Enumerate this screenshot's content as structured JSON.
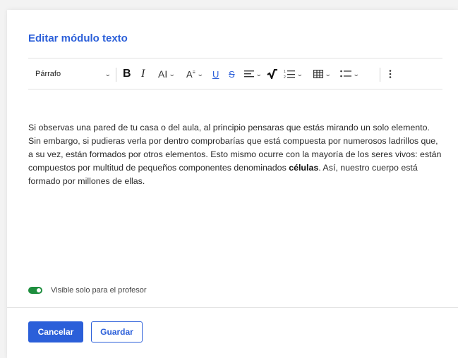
{
  "dialog": {
    "title": "Editar módulo texto"
  },
  "toolbar": {
    "paragraph_style": "Párrafo",
    "tools": [
      {
        "name": "paragraph-style-dropdown",
        "icon": "chevron-down-icon"
      },
      {
        "name": "bold-button",
        "icon": "bold-icon",
        "glyph": "B"
      },
      {
        "name": "italic-button",
        "icon": "italic-icon",
        "glyph": "I"
      },
      {
        "name": "font-size-button",
        "icon": "font-size-icon",
        "glyph": "AI"
      },
      {
        "name": "text-color-button",
        "icon": "text-color-icon",
        "glyph": "A"
      },
      {
        "name": "underline-button",
        "icon": "underline-icon",
        "glyph": "U"
      },
      {
        "name": "strikethrough-button",
        "icon": "strikethrough-icon",
        "glyph": "S"
      },
      {
        "name": "align-button",
        "icon": "align-left-icon"
      },
      {
        "name": "math-button",
        "icon": "square-root-icon"
      },
      {
        "name": "numbered-list-button",
        "icon": "numbered-list-icon"
      },
      {
        "name": "table-button",
        "icon": "table-icon"
      },
      {
        "name": "bulleted-list-button",
        "icon": "bulleted-list-icon"
      },
      {
        "name": "more-options-button",
        "icon": "vertical-dots-icon"
      }
    ]
  },
  "content": {
    "text_before": "Si observas una pared de tu casa o del aula, al principio pensaras que estás mirando un solo elemento. Sin embargo, si pudieras verla por dentro comprobarías que está compuesta por numerosos ladrillos que, a su vez, están formados por otros elementos. Esto mismo ocurre con la mayoría de los seres vivos: están compuestos por multitud de pequeños componentes denominados ",
    "text_bold": "células",
    "text_after": ". Así, nuestro cuerpo está formado por millones de ellas."
  },
  "visibility": {
    "label": "Visible solo para el profesor",
    "enabled": true,
    "color": "#1e8e3e"
  },
  "footer": {
    "cancel_label": "Cancelar",
    "save_label": "Guardar"
  },
  "colors": {
    "accent": "#2b5fd9"
  }
}
